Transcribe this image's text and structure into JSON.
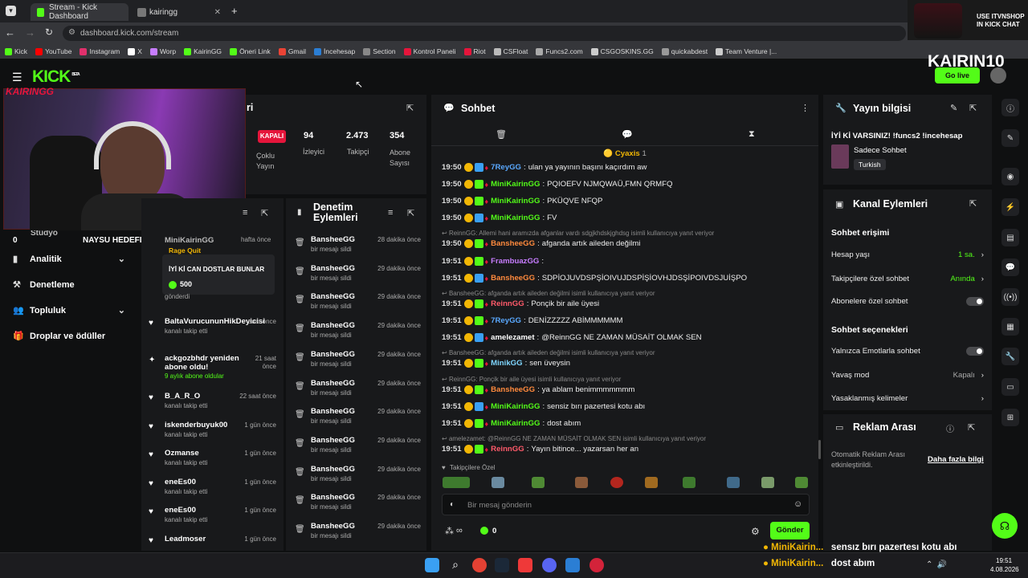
{
  "browser": {
    "tabs": [
      {
        "label": "Stream - Kick Dashboard"
      },
      {
        "label": "kairingg"
      }
    ],
    "url": "dashboard.kick.com/stream",
    "bookmarks": [
      "Kick",
      "YouTube",
      "Instagram",
      "X",
      "Worp",
      "KairinGG",
      "Öneri Link",
      "Gmail",
      "İncehesap",
      "Section",
      "Kontrol Paneli",
      "Riot",
      "CSFloat",
      "Funcs2.com",
      "CSGOSKINS.GG",
      "quickabdest",
      "Team Venture |..."
    ],
    "promo": "USE ITVNSHOP IN KICK CHAT"
  },
  "header": {
    "logo": "KICK",
    "logo_beta": "BETA",
    "channel_big": "KAIRIN10",
    "go_live": "Go live"
  },
  "overlay": {
    "webcam_tag": "KAIRINGG",
    "goals_label": "NAYSU HEDEFLER",
    "goals_value": "10",
    "stat0": "0"
  },
  "stream_stats": {
    "title_fragment": "ri",
    "status": "KAPALI",
    "status_sub": "Çoklu Yayın",
    "viewers_value": "94",
    "viewers_label": "İzleyici",
    "followers_value": "2.473",
    "followers_label": "Takipçi",
    "subs_value": "354",
    "subs_label": "Abone Sayısı"
  },
  "sidebar": {
    "items": [
      {
        "label": "Analitik",
        "chevron": true
      },
      {
        "label": "Denetleme",
        "chevron": false
      },
      {
        "label": "Topluluk",
        "chevron": true
      },
      {
        "label": "Droplar ve ödüller",
        "chevron": false
      }
    ],
    "partial_label": "Stüdyo"
  },
  "activity": {
    "top_time": "hafta önce",
    "top_user": "MiniKairinGG",
    "top_sub": "Rage Quit",
    "top_msg": "İYİ Kİ CAN DOSTLAR BUNLAR",
    "top_amount": "500",
    "top_action": "gönderdi",
    "rows": [
      {
        "name": "BaltaVurucununHikDeyicisi",
        "sub": "kanalı takip etti",
        "time": "saat önce"
      },
      {
        "name": "ackgozbhdr yeniden abone oldu!",
        "sub": "9 aylık abone oldular",
        "time": "21 saat önce"
      },
      {
        "name": "B_A_R_O",
        "sub": "kanalı takip etti",
        "time": "22 saat önce"
      },
      {
        "name": "iskenderbuyuk00",
        "sub": "kanalı takip etti",
        "time": "1 gün önce"
      },
      {
        "name": "Ozmanse",
        "sub": "kanalı takip etti",
        "time": "1 gün önce"
      },
      {
        "name": "eneEs00",
        "sub": "kanalı takip etti",
        "time": "1 gün önce"
      },
      {
        "name": "eneEs00",
        "sub": "kanalı takip etti",
        "time": "1 gün önce"
      },
      {
        "name": "Leadmoser",
        "sub": "",
        "time": "1 gün önce"
      }
    ]
  },
  "moderation": {
    "title": "Denetim Eylemleri",
    "rows": [
      {
        "name": "BansheeGG",
        "sub": "bir mesajı sildi",
        "time": "28 dakika önce"
      },
      {
        "name": "BansheeGG",
        "sub": "bir mesajı sildi",
        "time": "29 dakika önce"
      },
      {
        "name": "BansheeGG",
        "sub": "bir mesajı sildi",
        "time": "29 dakika önce"
      },
      {
        "name": "BansheeGG",
        "sub": "bir mesajı sildi",
        "time": "29 dakika önce"
      },
      {
        "name": "BansheeGG",
        "sub": "bir mesajı sildi",
        "time": "29 dakika önce"
      },
      {
        "name": "BansheeGG",
        "sub": "bir mesajı sildi",
        "time": "29 dakika önce"
      },
      {
        "name": "BansheeGG",
        "sub": "bir mesajı sildi",
        "time": "29 dakika önce"
      },
      {
        "name": "BansheeGG",
        "sub": "bir mesajı sildi",
        "time": "29 dakika önce"
      },
      {
        "name": "BansheeGG",
        "sub": "bir mesajı sildi",
        "time": "29 dakika önce"
      },
      {
        "name": "BansheeGG",
        "sub": "bir mesajı sildi",
        "time": "29 dakika önce"
      },
      {
        "name": "BansheeGG",
        "sub": "bir mesajı sildi",
        "time": "29 dakika önce"
      }
    ]
  },
  "chat": {
    "title": "Sohbet",
    "pinned_user": "Cyaxis",
    "pinned_count": "1",
    "messages": [
      {
        "time": "19:50",
        "user": "7ReyGG",
        "color": "#5aa9ff",
        "text": "ulan ya yayının başını kaçırdım aw",
        "reply": ""
      },
      {
        "time": "19:50",
        "user": "MiniKairinGG",
        "color": "#53fc18",
        "text": "PQIOEFV NJMQWAÜ,FMN QRMFQ",
        "reply": ""
      },
      {
        "time": "19:50",
        "user": "MiniKairinGG",
        "color": "#53fc18",
        "text": "PKÜQVE NFQP",
        "reply": ""
      },
      {
        "time": "19:50",
        "user": "MiniKairinGG",
        "color": "#53fc18",
        "text": "FV",
        "reply": ""
      },
      {
        "time": "19:50",
        "user": "BansheeGG",
        "color": "#ff8a3d",
        "text": "afganda artık aileden değilmi",
        "reply": "ReinnGG: Allemi hani aramızda afganlar vardı sdgjkhdskjghdsg isimli kullanıcıya yanıt veriyor"
      },
      {
        "time": "19:51",
        "user": "FrambuazGG",
        "color": "#c77dff",
        "text": "",
        "reply": ""
      },
      {
        "time": "19:51",
        "user": "BansheeGG",
        "color": "#ff8a3d",
        "text": "SDPİOJUVDSPŞİOIVUJDSPİŞİOVHJDSŞİPOIVDSJUİŞPO",
        "reply": ""
      },
      {
        "time": "19:51",
        "user": "ReinnGG",
        "color": "#ff5a6a",
        "text": "Ponçik bir aile üyesi",
        "reply": "BansheeGG: afganda artık aileden değilmi isimli kullanıcıya yanıt veriyor"
      },
      {
        "time": "19:51",
        "user": "7ReyGG",
        "color": "#5aa9ff",
        "text": "DENİZZZZZ ABİMMMMMM",
        "reply": ""
      },
      {
        "time": "19:51",
        "user": "amelezamet",
        "color": "#ffffff",
        "text": "@ReinnGG NE ZAMAN MÜSAİT OLMAK SEN",
        "reply": ""
      },
      {
        "time": "19:51",
        "user": "MinikGG",
        "color": "#7fd6ff",
        "text": "sen üveysin",
        "reply": "BansheeGG: afganda artık aileden değilmi isimli kullanıcıya yanıt veriyor"
      },
      {
        "time": "19:51",
        "user": "BansheeGG",
        "color": "#ff8a3d",
        "text": "ya ablam benimmmmmmm",
        "reply": "ReinnGG: Ponçik bir aile üyesi isimli kullanıcıya yanıt veriyor"
      },
      {
        "time": "19:51",
        "user": "MiniKairinGG",
        "color": "#53fc18",
        "text": "sensiz bırı pazertesi kotu abı",
        "reply": ""
      },
      {
        "time": "19:51",
        "user": "MiniKairinGG",
        "color": "#53fc18",
        "text": "dost abım",
        "reply": ""
      },
      {
        "time": "19:51",
        "user": "ReinnGG",
        "color": "#ff5a6a",
        "text": "Yayın bitince... yazarsan her an",
        "reply": "amelezamet: @ReinnGG NE ZAMAN MÜSAİT OLMAK SEN isimli kullanıcıya yanıt veriyor"
      }
    ],
    "emote_label": "Takipçilere Özel",
    "input_placeholder": "Bir mesaj gönderin",
    "send_label": "Gönder",
    "infinity": "∞",
    "points": "0"
  },
  "stream_info": {
    "title": "Yayın bilgisi",
    "stream_title": "İYİ Kİ VARSINIZ! !funcs2 !incehesap",
    "category": "Sadece Sohbet",
    "language": "Turkish"
  },
  "channel_actions": {
    "title": "Kanal Eylemleri",
    "chat_access": "Sohbet erişimi",
    "account_age": "Hesap yaşı",
    "account_age_value": "1 sa.",
    "followers_only": "Takipçilere özel sohbet",
    "followers_only_value": "Anında",
    "subs_only": "Abonelere özel sohbet",
    "chat_options": "Sohbet seçenekleri",
    "emote_only": "Yalnızca Emotlarla sohbet",
    "slow_mode": "Yavaş mod",
    "slow_mode_value": "Kapalı",
    "banned_words": "Yasaklanmış kelimeler"
  },
  "ad_break": {
    "title": "Reklam Arası",
    "text": "Otomatik Reklam Arası etkinleştirildi.",
    "link": "Daha fazla bilgi"
  },
  "overlay_chat": [
    {
      "user": "MiniKairin...",
      "text": "sensız bırı pazertesı kotu abı"
    },
    {
      "user": "MiniKairin...",
      "text": "dost abım"
    }
  ],
  "clock": {
    "time": "19:51",
    "date": "4.08.2026"
  },
  "colors": {
    "accent": "#53fc18",
    "kapali": "#e5153b"
  }
}
